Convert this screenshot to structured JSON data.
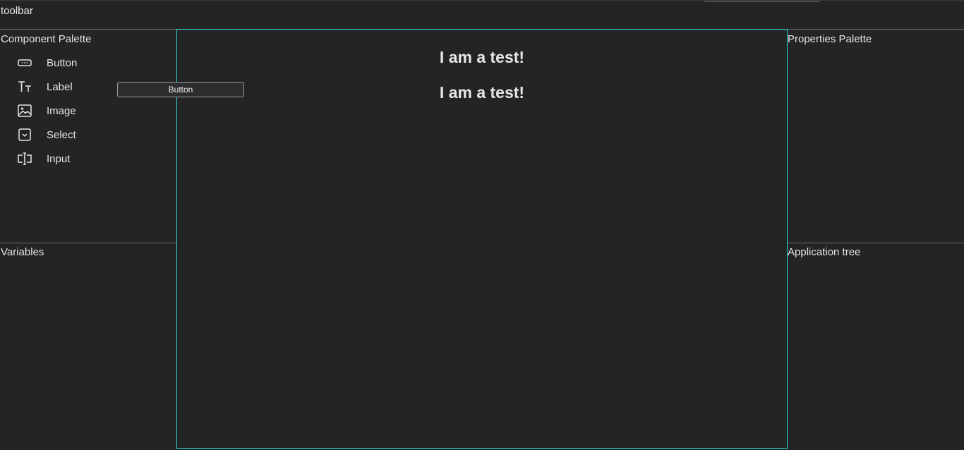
{
  "toolbar": {
    "label": "toolbar"
  },
  "component_palette": {
    "title": "Component Palette",
    "items": [
      {
        "label": "Button",
        "icon": "button-icon"
      },
      {
        "label": "Label",
        "icon": "text-size-icon"
      },
      {
        "label": "Image",
        "icon": "image-icon"
      },
      {
        "label": "Select",
        "icon": "select-icon"
      },
      {
        "label": "Input",
        "icon": "text-input-icon"
      }
    ]
  },
  "variables": {
    "title": "Variables"
  },
  "properties_palette": {
    "title": "Properties Palette"
  },
  "application_tree": {
    "title": "Application tree"
  },
  "canvas": {
    "border_color": "#2ed6d6",
    "texts": [
      "I am a test!",
      "I am a test!"
    ]
  },
  "dragging_component": {
    "label": "Button"
  }
}
